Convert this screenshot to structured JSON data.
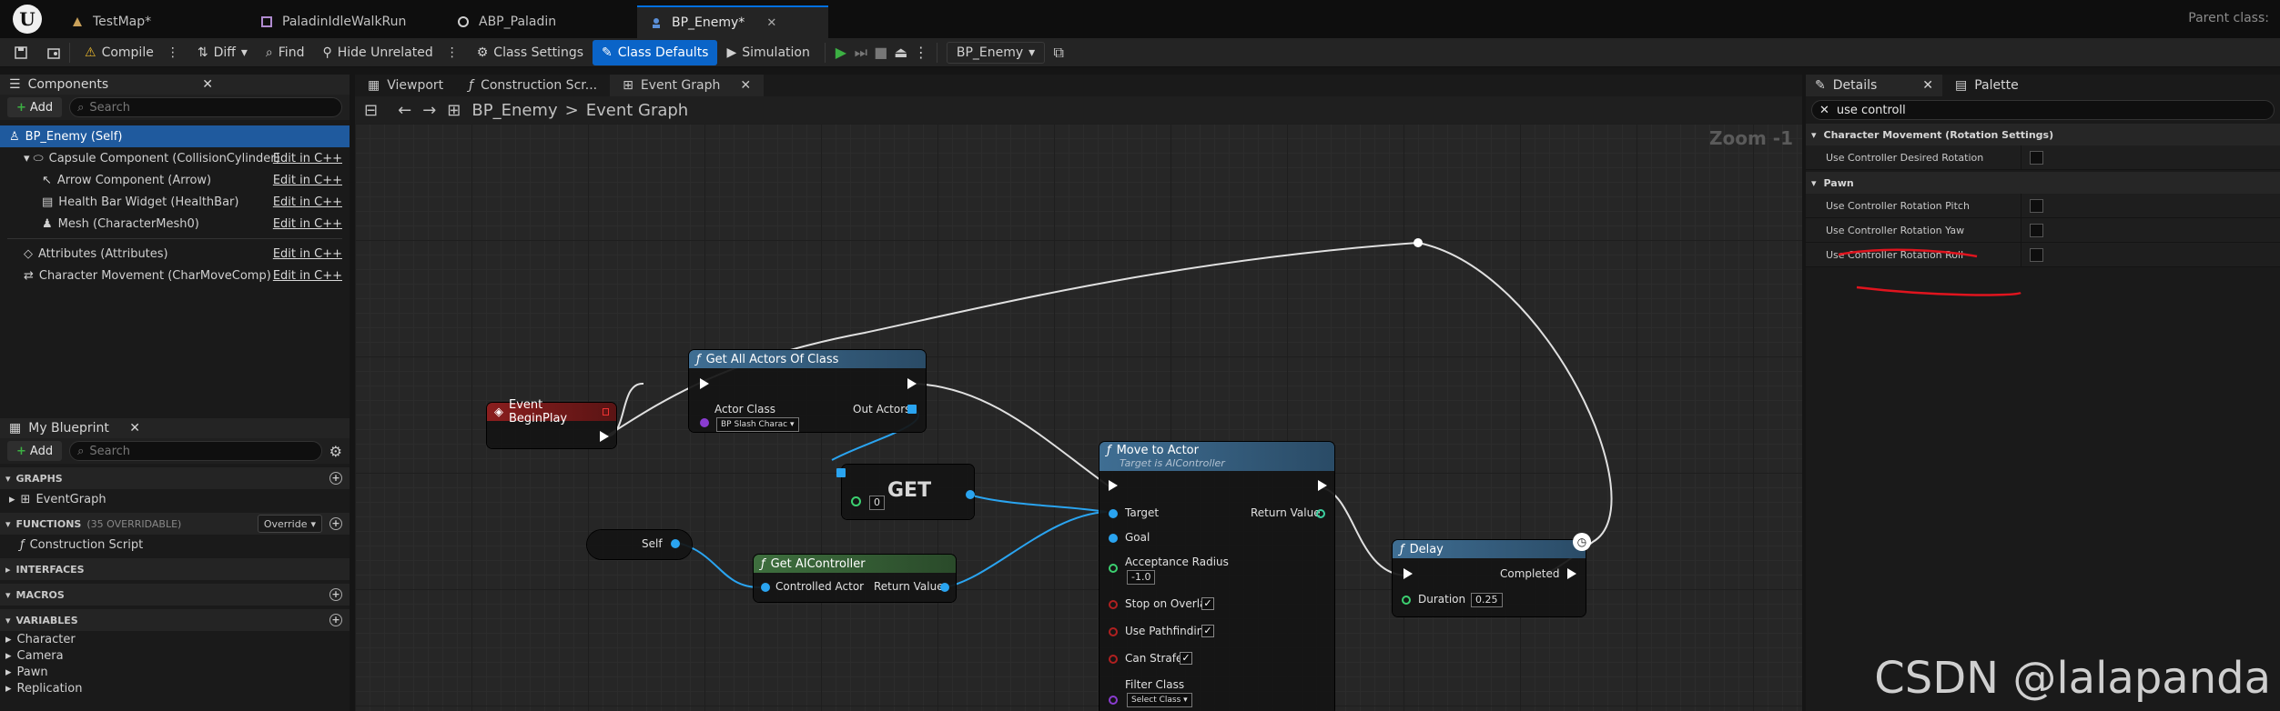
{
  "title_bar": {
    "logo": "U",
    "tabs": [
      {
        "label": "TestMap*",
        "icon": "level-icon"
      },
      {
        "label": "PaladinIdleWalkRun",
        "icon": "blendspace-icon"
      },
      {
        "label": "ABP_Paladin",
        "icon": "anim-blueprint-icon"
      },
      {
        "label": "BP_Enemy*",
        "icon": "blueprint-icon",
        "close": "✕"
      }
    ],
    "parent_class": "Parent class:"
  },
  "toolbar": {
    "compile": "Compile",
    "diff": "Diff",
    "find": "Find",
    "hide_unrelated": "Hide Unrelated",
    "class_settings": "Class Settings",
    "class_defaults": "Class Defaults",
    "simulation": "Simulation",
    "debug_object": "BP_Enemy"
  },
  "components_panel": {
    "title": "Components",
    "add": "Add",
    "search_placeholder": "Search",
    "items": [
      {
        "label": "BP_Enemy (Self)",
        "edit": ""
      },
      {
        "label": "Capsule Component (CollisionCylinder)",
        "edit": "Edit in C++"
      },
      {
        "label": "Arrow Component (Arrow)",
        "edit": "Edit in C++"
      },
      {
        "label": "Health Bar Widget (HealthBar)",
        "edit": "Edit in C++"
      },
      {
        "label": "Mesh (CharacterMesh0)",
        "edit": "Edit in C++"
      },
      {
        "label": "Attributes (Attributes)",
        "edit": "Edit in C++"
      },
      {
        "label": "Character Movement (CharMoveComp)",
        "edit": "Edit in C++"
      }
    ]
  },
  "my_blueprint": {
    "title": "My Blueprint",
    "add": "Add",
    "search_placeholder": "Search",
    "graphs": "GRAPHS",
    "event_graph": "EventGraph",
    "functions": "FUNCTIONS",
    "functions_count": "(35 OVERRIDABLE)",
    "override": "Override",
    "construction_script": "Construction Script",
    "interfaces": "INTERFACES",
    "macros": "MACROS",
    "variables": "VARIABLES",
    "var_groups": [
      "Character",
      "Camera",
      "Pawn",
      "Replication"
    ]
  },
  "graph_tabs": [
    {
      "label": "Viewport"
    },
    {
      "label": "Construction Scr..."
    },
    {
      "label": "Event Graph",
      "close": "✕"
    }
  ],
  "breadcrumb": {
    "root": "BP_Enemy",
    "sep": ">",
    "current": "Event Graph"
  },
  "zoom": "Zoom -1",
  "nodes": {
    "begin_play": {
      "title": "Event BeginPlay"
    },
    "get_all_actors": {
      "title": "Get All Actors Of Class",
      "actor_class": "Actor Class",
      "class_value": "BP Slash Charac",
      "out_actors": "Out Actors"
    },
    "get": {
      "title": "GET",
      "index": "0"
    },
    "self": {
      "title": "Self"
    },
    "get_ai_controller": {
      "title": "Get AIController",
      "controlled_actor": "Controlled Actor",
      "return_value": "Return Value"
    },
    "move_to_actor": {
      "title": "Move to Actor",
      "subtitle": "Target is AIController",
      "target": "Target",
      "return_value": "Return Value",
      "goal": "Goal",
      "acceptance_radius": "Acceptance Radius",
      "acceptance_value": "-1.0",
      "stop_on_overlap": "Stop on Overlap",
      "use_pathfinding": "Use Pathfinding",
      "can_strafe": "Can Strafe",
      "filter_class": "Filter Class",
      "filter_value": "Select Class"
    },
    "delay": {
      "title": "Delay",
      "completed": "Completed",
      "duration": "Duration",
      "duration_value": "0.25"
    }
  },
  "details": {
    "title": "Details",
    "palette": "Palette",
    "search_value": "use controll",
    "categories": [
      {
        "name": "Character Movement (Rotation Settings)",
        "props": [
          "Use Controller Desired Rotation"
        ]
      },
      {
        "name": "Pawn",
        "props": [
          "Use Controller Rotation Pitch",
          "Use Controller Rotation Yaw",
          "Use Controller Rotation Roll"
        ]
      }
    ]
  },
  "watermark": "CSDN @lalapanda",
  "colors": {
    "accent": "#0a64c8",
    "event_head": "#8a1e1e",
    "function_head": "#3f6e93",
    "pure_head": "#3e6f3e",
    "exec_wire": "#e0e0e0",
    "object_wire": "#2aa4f0",
    "annotation": "#e0141e"
  }
}
